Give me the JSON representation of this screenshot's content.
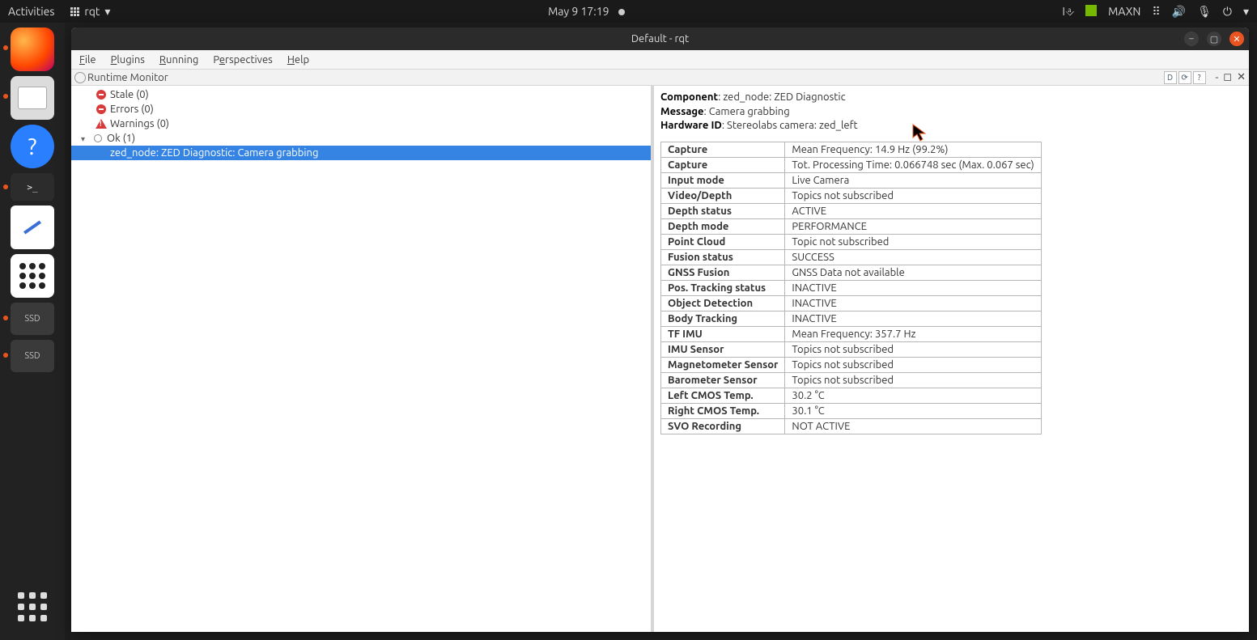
{
  "topbar": {
    "activities": "Activities",
    "app": "rqt",
    "datetime": "May 9  17:19",
    "mode": "MAXN"
  },
  "launcher": {
    "ssd": "SSD"
  },
  "window": {
    "title": "Default - rqt"
  },
  "menubar": {
    "file": "File",
    "plugins": "Plugins",
    "running": "Running",
    "perspectives": "Perspectives",
    "help": "Help"
  },
  "pluginbar": {
    "title": "Runtime Monitor",
    "d": "D"
  },
  "tree": {
    "stale": "Stale (0)",
    "errors": "Errors (0)",
    "warnings": "Warnings (0)",
    "ok": "Ok (1)",
    "node": "zed_node: ZED Diagnostic: Camera grabbing"
  },
  "info": {
    "component_k": "Component",
    "component_v": ": zed_node: ZED Diagnostic",
    "message_k": "Message",
    "message_v": ": Camera grabbing",
    "hwid_k": "Hardware ID",
    "hwid_v": ": Stereolabs camera: zed_left"
  },
  "diag": [
    {
      "k": "Capture",
      "v": "Mean Frequency: 14.9 Hz (99.2%)"
    },
    {
      "k": "Capture",
      "v": "Tot. Processing Time: 0.066748 sec (Max. 0.067 sec)"
    },
    {
      "k": "Input mode",
      "v": "Live Camera"
    },
    {
      "k": "Video/Depth",
      "v": "Topics not subscribed"
    },
    {
      "k": "Depth status",
      "v": "ACTIVE"
    },
    {
      "k": "Depth mode",
      "v": "PERFORMANCE"
    },
    {
      "k": "Point Cloud",
      "v": "Topic not subscribed"
    },
    {
      "k": "Fusion status",
      "v": "SUCCESS"
    },
    {
      "k": "GNSS Fusion",
      "v": "GNSS Data not available"
    },
    {
      "k": "Pos. Tracking status",
      "v": "INACTIVE"
    },
    {
      "k": "Object Detection",
      "v": "INACTIVE"
    },
    {
      "k": "Body Tracking",
      "v": "INACTIVE"
    },
    {
      "k": "TF IMU",
      "v": "Mean Frequency: 357.7 Hz"
    },
    {
      "k": "IMU Sensor",
      "v": "Topics not subscribed"
    },
    {
      "k": "Magnetometer Sensor",
      "v": "Topics not subscribed"
    },
    {
      "k": "Barometer Sensor",
      "v": "Topics not subscribed"
    },
    {
      "k": "Left CMOS Temp.",
      "v": "30.2 °C"
    },
    {
      "k": "Right CMOS Temp.",
      "v": "30.1 °C"
    },
    {
      "k": "SVO Recording",
      "v": "NOT ACTIVE"
    }
  ]
}
